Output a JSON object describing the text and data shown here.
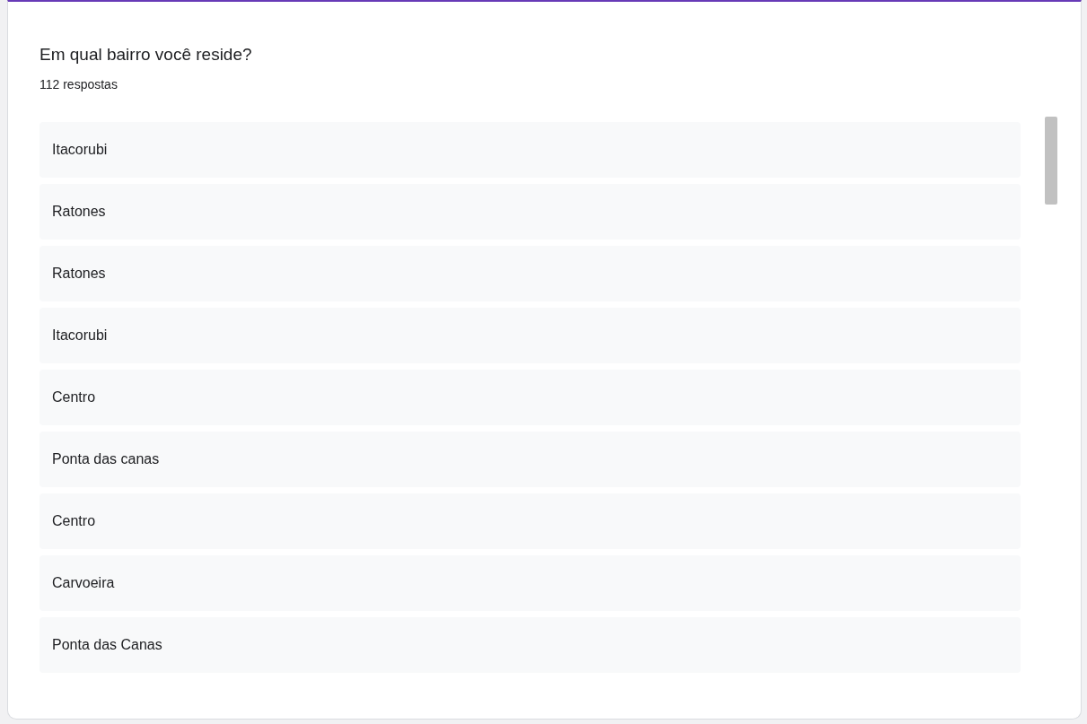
{
  "question": {
    "title": "Em qual bairro você reside?",
    "count": "112 respostas"
  },
  "responses": [
    "Itacorubi",
    "Ratones",
    "Ratones",
    "Itacorubi",
    "Centro",
    "Ponta das canas",
    "Centro",
    "Carvoeira",
    "Ponta das Canas"
  ]
}
